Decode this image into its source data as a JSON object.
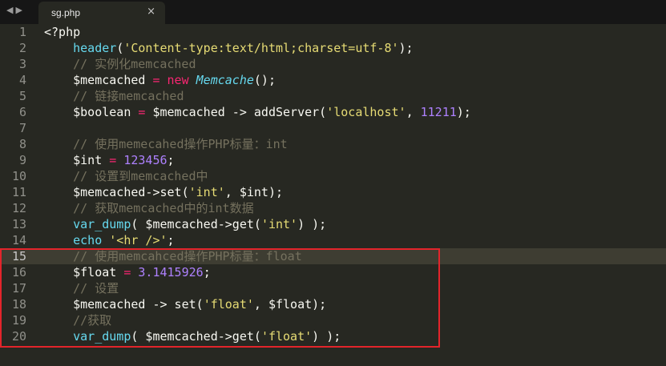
{
  "tab": {
    "title": "sg.php",
    "close_glyph": "×",
    "nav_glyphs": "◀▶"
  },
  "active_line": 15,
  "annotation": {
    "color": "#e3242b",
    "first_line": 15,
    "last_line": 20
  },
  "lines": [
    {
      "n": "1",
      "tokens": [
        {
          "t": "t",
          "v": "<?php"
        }
      ]
    },
    {
      "n": "2",
      "tokens": [
        {
          "t": "t",
          "v": "    "
        },
        {
          "t": "fn",
          "v": "header"
        },
        {
          "t": "t",
          "v": "("
        },
        {
          "t": "str",
          "v": "'Content-type:text/html;charset=utf-8'"
        },
        {
          "t": "t",
          "v": ");"
        }
      ]
    },
    {
      "n": "3",
      "tokens": [
        {
          "t": "t",
          "v": "    "
        },
        {
          "t": "cm",
          "v": "// 实例化memcached"
        }
      ]
    },
    {
      "n": "4",
      "tokens": [
        {
          "t": "t",
          "v": "    $memcached "
        },
        {
          "t": "kw",
          "v": "="
        },
        {
          "t": "t",
          "v": " "
        },
        {
          "t": "kw",
          "v": "new"
        },
        {
          "t": "t",
          "v": " "
        },
        {
          "t": "cls",
          "v": "Memcache"
        },
        {
          "t": "t",
          "v": "();"
        }
      ]
    },
    {
      "n": "5",
      "tokens": [
        {
          "t": "t",
          "v": "    "
        },
        {
          "t": "cm",
          "v": "// 链接memcached"
        }
      ]
    },
    {
      "n": "6",
      "tokens": [
        {
          "t": "t",
          "v": "    $boolean "
        },
        {
          "t": "kw",
          "v": "="
        },
        {
          "t": "t",
          "v": " $memcached -> addServer("
        },
        {
          "t": "str",
          "v": "'localhost'"
        },
        {
          "t": "t",
          "v": ", "
        },
        {
          "t": "num",
          "v": "11211"
        },
        {
          "t": "t",
          "v": ");"
        }
      ]
    },
    {
      "n": "7",
      "tokens": []
    },
    {
      "n": "8",
      "tokens": [
        {
          "t": "t",
          "v": "    "
        },
        {
          "t": "cm",
          "v": "// 使用memecahed操作PHP标量：int"
        }
      ]
    },
    {
      "n": "9",
      "tokens": [
        {
          "t": "t",
          "v": "    $int "
        },
        {
          "t": "kw",
          "v": "="
        },
        {
          "t": "t",
          "v": " "
        },
        {
          "t": "num",
          "v": "123456"
        },
        {
          "t": "t",
          "v": ";"
        }
      ]
    },
    {
      "n": "10",
      "tokens": [
        {
          "t": "t",
          "v": "    "
        },
        {
          "t": "cm",
          "v": "// 设置到memcached中"
        }
      ]
    },
    {
      "n": "11",
      "tokens": [
        {
          "t": "t",
          "v": "    $memcached->set("
        },
        {
          "t": "str",
          "v": "'int'"
        },
        {
          "t": "t",
          "v": ", $int);"
        }
      ]
    },
    {
      "n": "12",
      "tokens": [
        {
          "t": "t",
          "v": "    "
        },
        {
          "t": "cm",
          "v": "// 获取memcached中的int数据"
        }
      ]
    },
    {
      "n": "13",
      "tokens": [
        {
          "t": "t",
          "v": "    "
        },
        {
          "t": "fn",
          "v": "var_dump"
        },
        {
          "t": "t",
          "v": "( $memcached->get("
        },
        {
          "t": "str",
          "v": "'int'"
        },
        {
          "t": "t",
          "v": ") );"
        }
      ]
    },
    {
      "n": "14",
      "tokens": [
        {
          "t": "t",
          "v": "    "
        },
        {
          "t": "fn",
          "v": "echo"
        },
        {
          "t": "t",
          "v": " "
        },
        {
          "t": "str",
          "v": "'<hr />'"
        },
        {
          "t": "t",
          "v": ";"
        }
      ]
    },
    {
      "n": "15",
      "tokens": [
        {
          "t": "t",
          "v": "    "
        },
        {
          "t": "cm",
          "v": "// 使用memcahced操作PHP标量：float"
        }
      ]
    },
    {
      "n": "16",
      "tokens": [
        {
          "t": "t",
          "v": "    $float "
        },
        {
          "t": "kw",
          "v": "="
        },
        {
          "t": "t",
          "v": " "
        },
        {
          "t": "num",
          "v": "3.1415926"
        },
        {
          "t": "t",
          "v": ";"
        }
      ]
    },
    {
      "n": "17",
      "tokens": [
        {
          "t": "t",
          "v": "    "
        },
        {
          "t": "cm",
          "v": "// 设置"
        }
      ]
    },
    {
      "n": "18",
      "tokens": [
        {
          "t": "t",
          "v": "    $memcached -> set("
        },
        {
          "t": "str",
          "v": "'float'"
        },
        {
          "t": "t",
          "v": ", $float);"
        }
      ]
    },
    {
      "n": "19",
      "tokens": [
        {
          "t": "t",
          "v": "    "
        },
        {
          "t": "cm",
          "v": "//获取"
        }
      ]
    },
    {
      "n": "20",
      "tokens": [
        {
          "t": "t",
          "v": "    "
        },
        {
          "t": "fn",
          "v": "var_dump"
        },
        {
          "t": "t",
          "v": "( $memcached->get("
        },
        {
          "t": "str",
          "v": "'float'"
        },
        {
          "t": "t",
          "v": ") );"
        }
      ]
    }
  ]
}
